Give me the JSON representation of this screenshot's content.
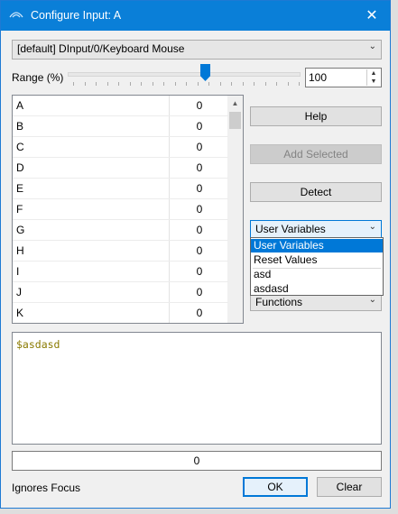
{
  "window": {
    "title": "Configure Input: A",
    "close_glyph": "✕"
  },
  "device": {
    "selected": "[default] DInput/0/Keyboard Mouse"
  },
  "range": {
    "label": "Range (%)",
    "value": "100",
    "slider_fraction": 0.6
  },
  "keys": [
    {
      "key": "A",
      "value": "0"
    },
    {
      "key": "B",
      "value": "0"
    },
    {
      "key": "C",
      "value": "0"
    },
    {
      "key": "D",
      "value": "0"
    },
    {
      "key": "E",
      "value": "0"
    },
    {
      "key": "F",
      "value": "0"
    },
    {
      "key": "G",
      "value": "0"
    },
    {
      "key": "H",
      "value": "0"
    },
    {
      "key": "I",
      "value": "0"
    },
    {
      "key": "J",
      "value": "0"
    },
    {
      "key": "K",
      "value": "0"
    }
  ],
  "buttons": {
    "help": "Help",
    "add_selected": "Add Selected",
    "detect": "Detect",
    "ok": "OK",
    "cancel": "Clear"
  },
  "variables_dropdown": {
    "selected": "User Variables",
    "options": [
      "User Variables",
      "Reset Values",
      "asd",
      "asdasd"
    ]
  },
  "functions_dropdown": {
    "selected": "Functions"
  },
  "expression": "$asdasd",
  "result_value": "0",
  "ignores_focus_label": "Ignores Focus",
  "icons": {
    "title": "controller-icon",
    "close": "close-icon",
    "dropdown": "chevron-down-icon"
  },
  "colors": {
    "titlebar": "#0a7fd8",
    "selection": "#0078d7",
    "expression_text": "#8a7a00"
  }
}
